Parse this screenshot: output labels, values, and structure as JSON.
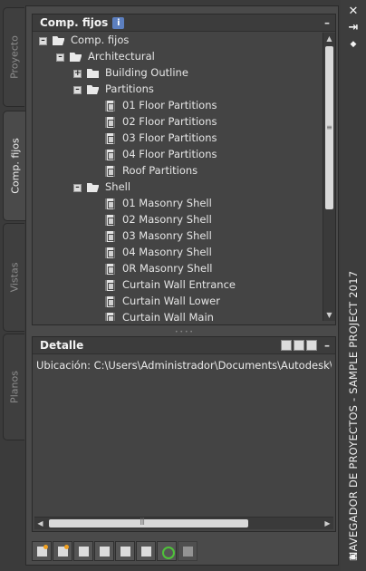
{
  "left_tabs": [
    {
      "label": "Proyecto",
      "active": false
    },
    {
      "label": "Comp. fijos",
      "active": true
    },
    {
      "label": "Vistas",
      "active": false
    },
    {
      "label": "Planos",
      "active": false
    }
  ],
  "tree_panel": {
    "title": "Comp. fijos",
    "info_icon": "i",
    "minimize": "–",
    "items": [
      {
        "label": "Comp. fijos",
        "icon": "folder-open",
        "expander": "–"
      },
      {
        "label": "Architectural",
        "icon": "folder-open",
        "expander": "–"
      },
      {
        "label": "Building Outline",
        "icon": "folder-closed",
        "expander": "+"
      },
      {
        "label": "Partitions",
        "icon": "folder-open",
        "expander": "–"
      },
      {
        "label": "01 Floor Partitions",
        "icon": "construct-icon",
        "expander": ""
      },
      {
        "label": "02 Floor Partitions",
        "icon": "construct-icon",
        "expander": ""
      },
      {
        "label": "03 Floor Partitions",
        "icon": "construct-icon",
        "expander": ""
      },
      {
        "label": "04 Floor Partitions",
        "icon": "construct-icon",
        "expander": ""
      },
      {
        "label": "Roof Partitions",
        "icon": "construct-icon",
        "expander": ""
      },
      {
        "label": "Shell",
        "icon": "folder-open",
        "expander": "–"
      },
      {
        "label": "01 Masonry Shell",
        "icon": "construct-icon",
        "expander": ""
      },
      {
        "label": "02 Masonry Shell",
        "icon": "construct-icon",
        "expander": ""
      },
      {
        "label": "03 Masonry Shell",
        "icon": "construct-icon",
        "expander": ""
      },
      {
        "label": "04 Masonry Shell",
        "icon": "construct-icon",
        "expander": ""
      },
      {
        "label": "0R Masonry Shell",
        "icon": "construct-icon",
        "expander": ""
      },
      {
        "label": "Curtain Wall Entrance",
        "icon": "construct-icon",
        "expander": ""
      },
      {
        "label": "Curtain Wall Lower",
        "icon": "construct-icon",
        "expander": ""
      },
      {
        "label": "Curtain Wall Main",
        "icon": "construct-icon",
        "expander": ""
      }
    ]
  },
  "detail_panel": {
    "title": "Detalle",
    "minimize": "–",
    "location_text": "Ubicación: C:\\Users\\Administrador\\Documents\\Autodesk\\Mis"
  },
  "toolbar": {
    "buttons": [
      "new-construct-icon",
      "new-category-icon",
      "add-existing-icon",
      "paste-icon",
      "select-icon",
      "properties-icon",
      "refresh-icon",
      "repath-icon"
    ]
  },
  "title_strip": {
    "close": "✕",
    "pin": "⇥",
    "options": "◆",
    "title": "NAVEGADOR DE PROYECTOS - SAMPLE PROJECT 2017"
  },
  "colors": {
    "background": "#3b3b3b",
    "panel": "#444444",
    "header": "#3c3c3c",
    "text": "#e6e6e6",
    "refresh_accent": "#4fc23a"
  }
}
